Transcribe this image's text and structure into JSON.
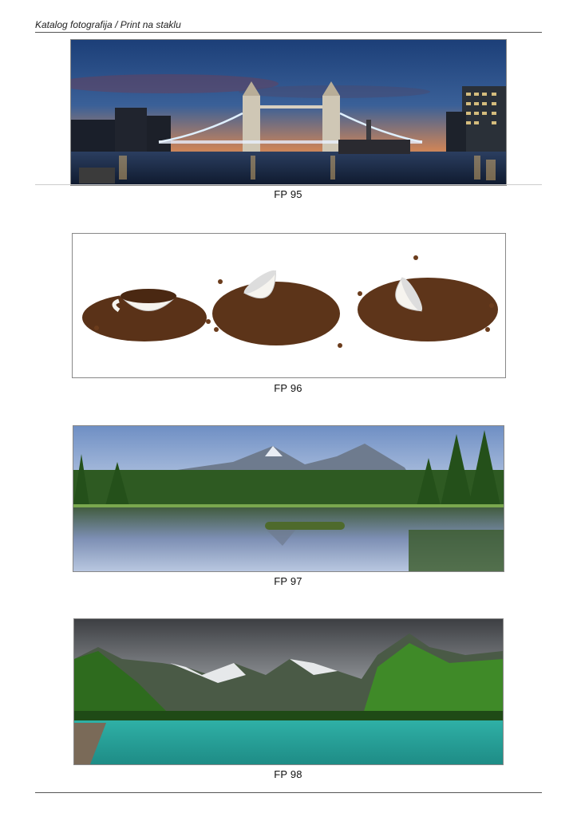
{
  "header": {
    "title": "Katalog fotografija / Print na staklu"
  },
  "items": [
    {
      "code": "FP 95",
      "image": "tower-bridge-london-night"
    },
    {
      "code": "FP 96",
      "image": "coffee-cups-beans"
    },
    {
      "code": "FP 97",
      "image": "forest-lake-mountains-reflection"
    },
    {
      "code": "FP 98",
      "image": "alpine-turquoise-lake"
    }
  ]
}
